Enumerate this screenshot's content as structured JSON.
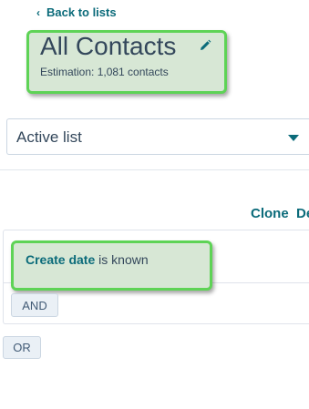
{
  "nav": {
    "back_icon": "chevron-left-icon",
    "back_label": "Back to lists"
  },
  "header": {
    "title": "All Contacts",
    "edit_icon": "pencil-icon",
    "estimation": "Estimation: 1,081 contacts"
  },
  "list_type": {
    "selected": "Active list",
    "caret_icon": "caret-down-icon"
  },
  "actions": {
    "clone_label": "Clone",
    "delete_label": "De"
  },
  "filters": [
    {
      "property": "Create date",
      "condition": "is known"
    }
  ],
  "buttons": {
    "and_label": "AND",
    "or_label": "OR"
  },
  "colors": {
    "link": "#0b6b7a",
    "highlight_border": "#5ed356",
    "highlight_fill": "#d7e7d5"
  }
}
